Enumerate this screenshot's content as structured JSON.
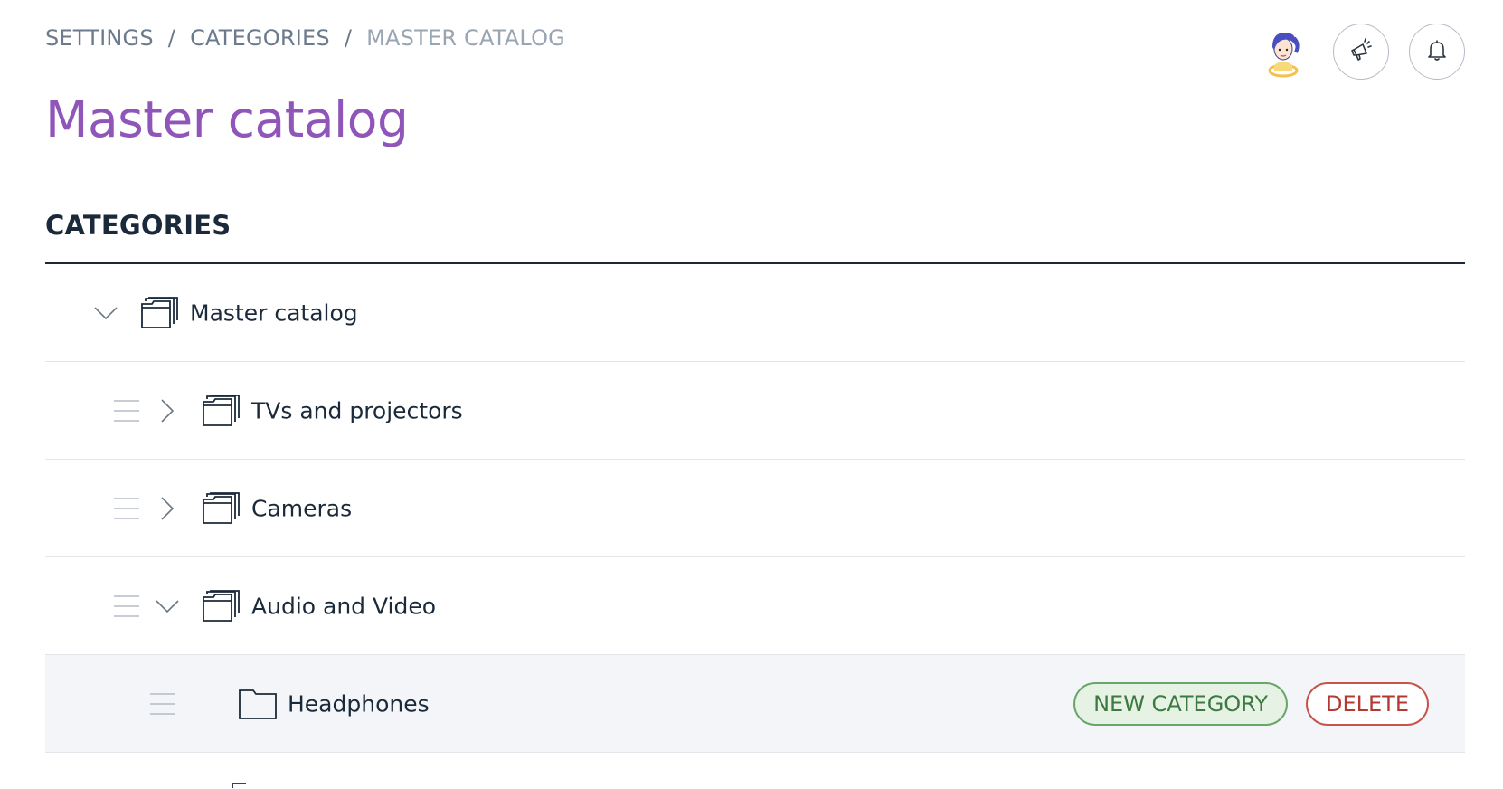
{
  "breadcrumb": {
    "items": [
      "SETTINGS",
      "CATEGORIES",
      "MASTER CATALOG"
    ],
    "separator": "/"
  },
  "page_title": "Master catalog",
  "section_title": "CATEGORIES",
  "header_icons": [
    "avatar",
    "megaphone-icon",
    "bell-icon"
  ],
  "tree": {
    "root": {
      "label": "Master catalog",
      "expanded": true
    },
    "items": [
      {
        "label": "TVs and projectors",
        "expanded": false,
        "depth": 1
      },
      {
        "label": "Cameras",
        "expanded": false,
        "depth": 1
      },
      {
        "label": "Audio and Video",
        "expanded": true,
        "depth": 1
      },
      {
        "label": "Headphones",
        "depth": 2,
        "selected": true
      }
    ]
  },
  "row_actions": {
    "new_category": "NEW CATEGORY",
    "delete": "DELETE"
  },
  "colors": {
    "title": "#8f55b8",
    "new_category": "#3d7a3f",
    "delete": "#b33a33",
    "selected_row_bg": "#f3f5f8"
  }
}
